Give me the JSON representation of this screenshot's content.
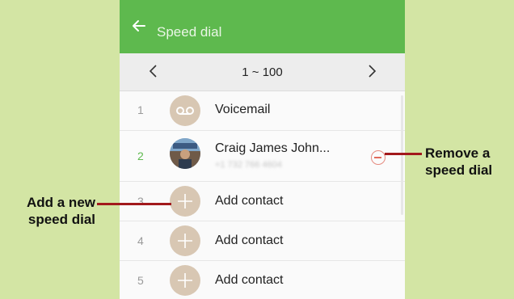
{
  "header": {
    "title": "Speed dial",
    "back_icon": "back-arrow-icon"
  },
  "pager": {
    "range": "1 ~ 100",
    "prev_icon": "chevron-left-icon",
    "next_icon": "chevron-right-icon"
  },
  "rows": [
    {
      "number": "1",
      "name": "Voicemail",
      "icon": "voicemail-icon"
    },
    {
      "number": "2",
      "name": "Craig James John...",
      "detail": "+1 732 766 4604",
      "remove_icon": "remove-icon"
    },
    {
      "number": "3",
      "name": "Add contact",
      "icon": "add-icon"
    },
    {
      "number": "4",
      "name": "Add contact",
      "icon": "add-icon"
    },
    {
      "number": "5",
      "name": "Add contact",
      "icon": "add-icon"
    }
  ],
  "callouts": {
    "remove": {
      "line1": "Remove a",
      "line2": "speed dial"
    },
    "add": {
      "line1": "Add a new",
      "line2": "speed dial"
    }
  },
  "colors": {
    "background": "#d3e5a4",
    "appbar": "#5eb94e",
    "callout_line": "#a2191c"
  }
}
